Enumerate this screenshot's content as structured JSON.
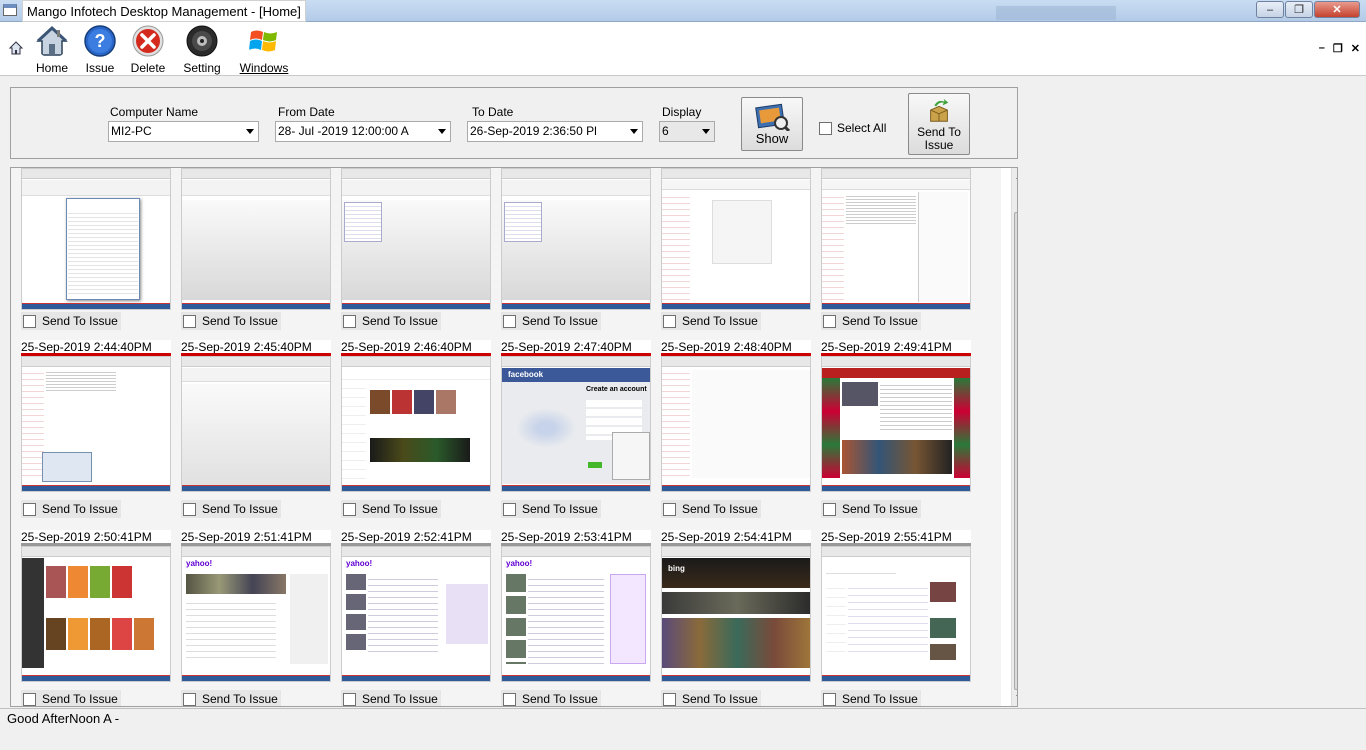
{
  "window": {
    "title": "Mango Infotech Desktop Management - [Home]",
    "controls": [
      "minimize",
      "maximize",
      "close"
    ]
  },
  "toolbar": {
    "items": [
      {
        "label": "Home",
        "icon": "house-icon"
      },
      {
        "label": "Issue",
        "icon": "help-icon"
      },
      {
        "label": "Delete",
        "icon": "delete-icon"
      },
      {
        "label": "Setting",
        "icon": "setting-icon"
      },
      {
        "label": "Windows",
        "icon": "windows-logo-icon"
      }
    ]
  },
  "filter": {
    "computer_name_label": "Computer Name",
    "computer_name_value": "MI2-PC",
    "from_date_label": "From Date",
    "from_date_value": "28- Jul -2019 12:00:00 A",
    "to_date_label": "To Date",
    "to_date_value": "26-Sep-2019   2:36:50 Pl",
    "display_label": "Display",
    "display_value": "6",
    "show_label": "Show",
    "select_all_label": "Select All",
    "send_to_issue_label": "Send To Issue"
  },
  "grid": {
    "send_label": "Send To Issue",
    "rows": [
      {
        "timestamps": [
          "",
          "",
          "",
          "",
          "",
          ""
        ]
      },
      {
        "timestamps": [
          "25-Sep-2019 2:44:40PM",
          "25-Sep-2019 2:45:40PM",
          "25-Sep-2019 2:46:40PM",
          "25-Sep-2019 2:47:40PM",
          "25-Sep-2019 2:48:40PM",
          "25-Sep-2019 2:49:41PM"
        ]
      },
      {
        "timestamps": [
          "25-Sep-2019 2:50:41PM",
          "25-Sep-2019 2:51:41PM",
          "25-Sep-2019 2:52:41PM",
          "25-Sep-2019 2:53:41PM",
          "25-Sep-2019 2:54:41PM",
          "25-Sep-2019 2:55:41PM"
        ]
      }
    ],
    "thumb_texts": {
      "facebook": "facebook",
      "create_account": "Create an account",
      "yahoo": "yahoo!",
      "bing": "bing"
    }
  },
  "status": {
    "text": "Good AfterNoon A -"
  },
  "colors": {
    "accent_red": "#cc0000",
    "taskbar_blue": "#2f5a9a",
    "facebook_blue": "#3b5998",
    "yahoo_purple": "#6001d2"
  }
}
